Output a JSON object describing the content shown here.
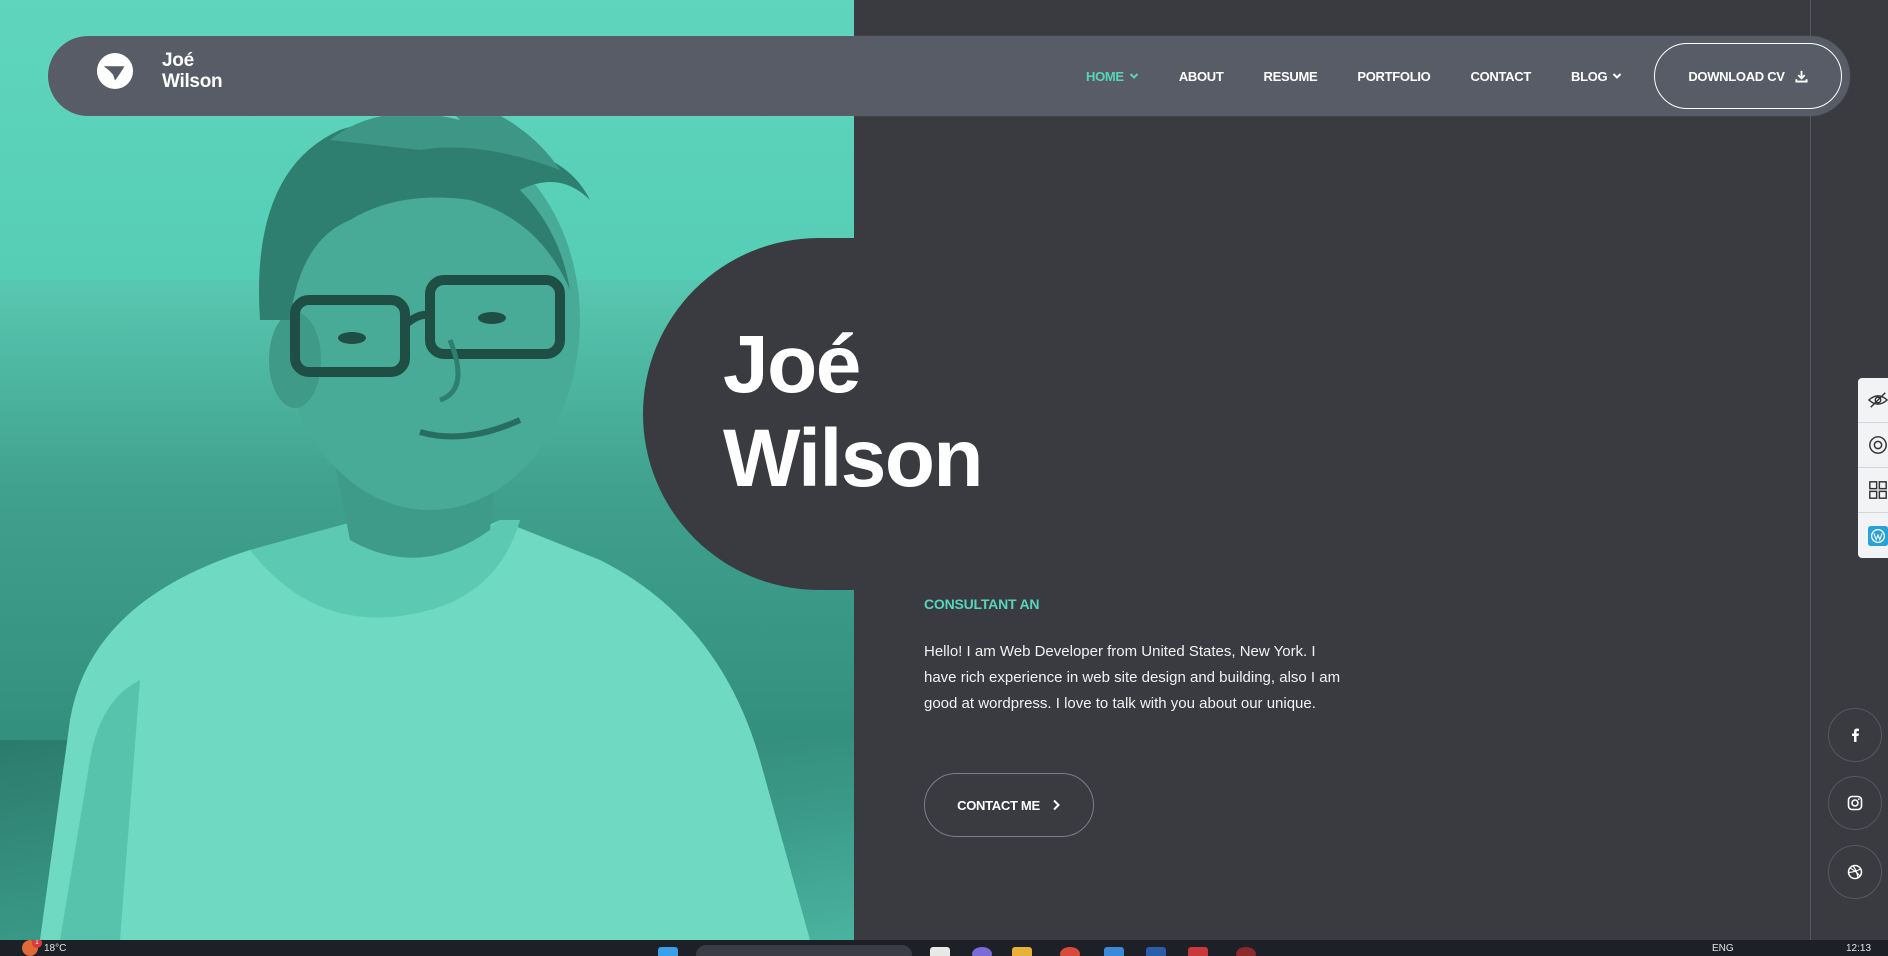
{
  "brand": {
    "name_line1": "Joé",
    "name_line2": "Wilson",
    "logo_icon": "bird-logo-icon"
  },
  "nav": {
    "items": [
      {
        "label": "HOME",
        "active": true,
        "has_dropdown": true
      },
      {
        "label": "ABOUT",
        "active": false,
        "has_dropdown": false
      },
      {
        "label": "RESUME",
        "active": false,
        "has_dropdown": false
      },
      {
        "label": "PORTFOLIO",
        "active": false,
        "has_dropdown": false
      },
      {
        "label": "CONTACT",
        "active": false,
        "has_dropdown": false
      },
      {
        "label": "BLOG",
        "active": false,
        "has_dropdown": true
      }
    ],
    "download_label": "DOWNLOAD CV",
    "download_icon": "download-icon"
  },
  "hero": {
    "name_line1": "Joé",
    "name_line2": "Wilson",
    "subtitle": "CONSULTANT AN",
    "intro": "Hello! I am Web Developer from United States, New York. I have rich experience in web site design and building, also I am good at wordpress. I love to talk with you about our unique.",
    "contact_label": "CONTACT ME",
    "contact_icon": "chevron-right-icon"
  },
  "tools": [
    "eye-slash-icon",
    "lifebuoy-icon",
    "grid-icon",
    "wordpress-icon"
  ],
  "socials": [
    "facebook-icon",
    "instagram-icon",
    "dribbble-icon"
  ],
  "colors": {
    "accent": "#57d5b9",
    "background": "#393b41",
    "navbar": "#585c66",
    "photo_tint": "#56cdb5"
  },
  "taskbar": {
    "weather": "18°C",
    "notification_count": "1",
    "chrome_badge": "2",
    "language": "ENG",
    "time": "12:13"
  }
}
